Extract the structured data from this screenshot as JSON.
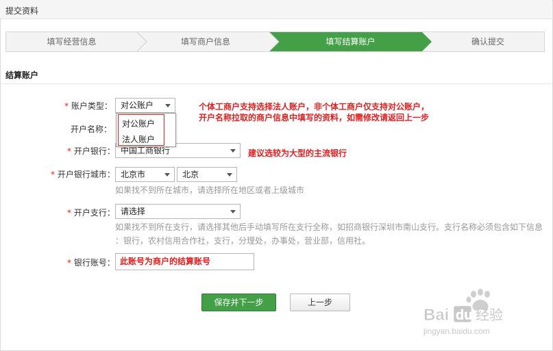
{
  "window": {
    "title": "提交资料"
  },
  "steps": [
    {
      "label": "填写经营信息",
      "active": false
    },
    {
      "label": "填写商户信息",
      "active": false
    },
    {
      "label": "填写结算账户",
      "active": true
    },
    {
      "label": "确认提交",
      "active": false
    }
  ],
  "section": {
    "title": "结算账户"
  },
  "form": {
    "account_type": {
      "required_mark": "*",
      "label": "账户类型：",
      "value": "对公账户"
    },
    "account_type_options": [
      "对公账户",
      "法人账户"
    ],
    "account_name": {
      "label": "开户名称："
    },
    "bank": {
      "required_mark": "*",
      "label": "开户银行：",
      "value": "中国工商银行"
    },
    "bank_city": {
      "required_mark": "*",
      "label": "开户银行城市：",
      "province": "北京市",
      "city": "北京",
      "hint": "如果找不到所在城市，请选择所在地区或者上级城市"
    },
    "branch": {
      "required_mark": "*",
      "label": "开户支行：",
      "value": "请选择",
      "hint_line1": "如果找不到所在支行，请选择其他后手动填写所在支行全称，如招商银行深圳市南山支行。支行名称必须包含如下信息",
      "hint_line2": "：银行，农村信用合作社，支行，分理处，办事处，营业部，信用社。"
    },
    "account_number": {
      "required_mark": "*",
      "label": "银行账号：",
      "value": "此账号为商户的结算账号"
    }
  },
  "annotations": {
    "note1_line1": "个体工商户支持选择法人账户，非个体工商户仅支持对公账户，",
    "note1_line2": "开户名称拉取的商户信息中填写的资料，如需修改请返回上一步",
    "note2": "建议选较为大型的主流银行"
  },
  "buttons": {
    "save_next": "保存并下一步",
    "prev": "上一步"
  },
  "watermark": {
    "brand": "Baidu经验",
    "url": "jingyan.baidu.com"
  },
  "colors": {
    "step_active": "#43a047",
    "required": "#e02020",
    "note": "#e02020"
  }
}
